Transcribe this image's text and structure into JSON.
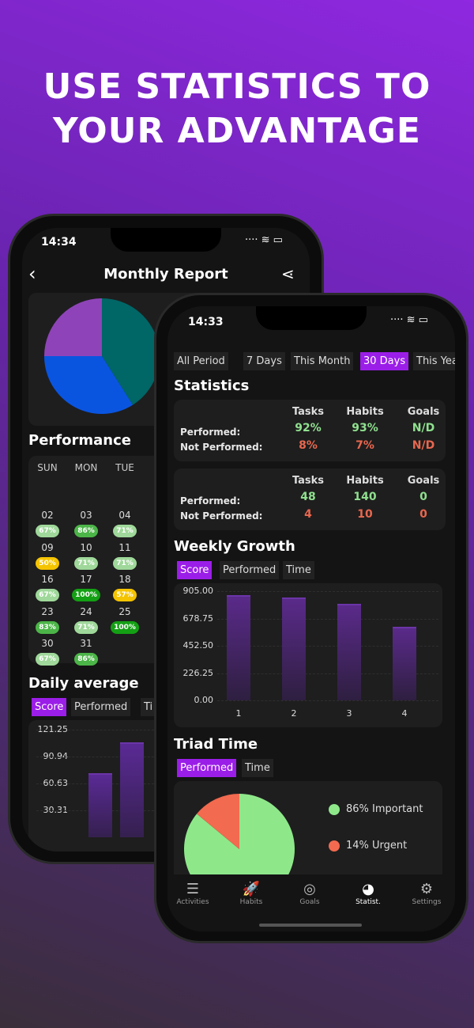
{
  "headline": [
    "USE STATISTICS TO",
    "YOUR ADVANTAGE"
  ],
  "back_phone": {
    "time": "14:34",
    "title": "Monthly Report",
    "pie": [
      {
        "share": 41,
        "color": "#006666"
      },
      {
        "share": 34,
        "color": "#0a55e0"
      },
      {
        "share": 25,
        "color": "#8e44b8"
      }
    ],
    "performance_title": "Performance",
    "weekdays": [
      "SUN",
      "MON",
      "TUE"
    ],
    "days": [
      {
        "d": "02",
        "p": "67%",
        "c": "#9fd89a"
      },
      {
        "d": "03",
        "p": "86%",
        "c": "#4cb548"
      },
      {
        "d": "04",
        "p": "71%",
        "c": "#9fd89a"
      },
      {
        "d": "09",
        "p": "50%",
        "c": "#f5c400"
      },
      {
        "d": "10",
        "p": "71%",
        "c": "#9fd89a"
      },
      {
        "d": "11",
        "p": "71%",
        "c": "#9fd89a"
      },
      {
        "d": "16",
        "p": "67%",
        "c": "#9fd89a"
      },
      {
        "d": "17",
        "p": "100%",
        "c": "#14a014"
      },
      {
        "d": "18",
        "p": "57%",
        "c": "#f5c400"
      },
      {
        "d": "23",
        "p": "83%",
        "c": "#4cb548"
      },
      {
        "d": "24",
        "p": "71%",
        "c": "#9fd89a"
      },
      {
        "d": "25",
        "p": "100%",
        "c": "#14a014"
      },
      {
        "d": "30",
        "p": "67%",
        "c": "#9fd89a"
      },
      {
        "d": "31",
        "p": "86%",
        "c": "#4cb548"
      }
    ],
    "daily_title": "Daily average",
    "daily_tabs": [
      "Score",
      "Performed",
      "Ti"
    ],
    "chart_data": {
      "type": "bar",
      "yticks": [
        "121.25",
        "90.94",
        "60.63",
        "30.31"
      ],
      "ylim": [
        0,
        121.25
      ],
      "values": [
        72,
        107
      ]
    }
  },
  "front_phone": {
    "time": "14:33",
    "periods": [
      "All Period",
      "7 Days",
      "This Month",
      "30 Days",
      "This Yea"
    ],
    "active_period": "30 Days",
    "stats_title": "Statistics",
    "percent_table": {
      "columns": [
        "Tasks",
        "Habits",
        "Goals"
      ],
      "performed_label": "Performed:",
      "not_performed_label": "Not Performed:",
      "performed": [
        "92%",
        "93%",
        "N/D"
      ],
      "not_performed": [
        "8%",
        "7%",
        "N/D"
      ]
    },
    "count_table": {
      "columns": [
        "Tasks",
        "Habits",
        "Goals"
      ],
      "performed_label": "Performed:",
      "not_performed_label": "Not Performed:",
      "performed": [
        "48",
        "140",
        "0"
      ],
      "not_performed": [
        "4",
        "10",
        "0"
      ]
    },
    "weekly_title": "Weekly Growth",
    "weekly_tabs": [
      "Score",
      "Performed",
      "Time"
    ],
    "chart_data": {
      "type": "bar",
      "categories": [
        "1",
        "2",
        "3",
        "4"
      ],
      "values": [
        872,
        853,
        800,
        610
      ],
      "yticks": [
        "905.00",
        "678.75",
        "452.50",
        "226.25",
        "0.00"
      ],
      "ylim": [
        0,
        905
      ],
      "grid": true,
      "bar_color": "#5a2a8a"
    },
    "triad_title": "Triad Time",
    "triad_tabs": [
      "Performed",
      "Time"
    ],
    "triad_chart": {
      "type": "pie",
      "slices": [
        {
          "label": "86% Important",
          "value": 86,
          "color": "#8ee88a"
        },
        {
          "label": "14% Urgent",
          "value": 14,
          "color": "#f26a4f"
        }
      ]
    },
    "nav": [
      {
        "label": "Activities",
        "icon": "list-icon",
        "glyph": "☰"
      },
      {
        "label": "Habits",
        "icon": "rocket-icon",
        "glyph": "🚀"
      },
      {
        "label": "Goals",
        "icon": "target-icon",
        "glyph": "◎"
      },
      {
        "label": "Statist.",
        "icon": "pie-chart-icon",
        "glyph": "◕"
      },
      {
        "label": "Settings",
        "icon": "gear-icon",
        "glyph": "⚙"
      }
    ],
    "active_nav": "Statist."
  }
}
